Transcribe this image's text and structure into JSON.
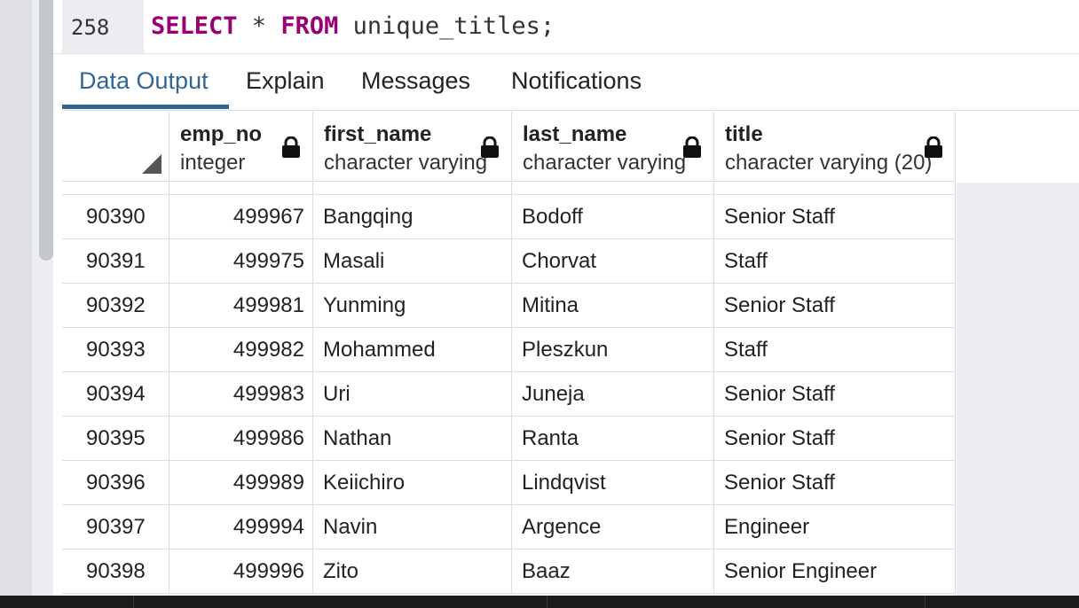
{
  "editor": {
    "line_number": "258",
    "kw_select": "SELECT",
    "star": " * ",
    "kw_from": "FROM",
    "rest": " unique_titles;"
  },
  "tabs": [
    {
      "label": "Data Output",
      "active": true
    },
    {
      "label": "Explain",
      "active": false
    },
    {
      "label": "Messages",
      "active": false
    },
    {
      "label": "Notifications",
      "active": false
    }
  ],
  "columns": [
    {
      "name": "emp_no",
      "type": "integer"
    },
    {
      "name": "first_name",
      "type": "character varying"
    },
    {
      "name": "last_name",
      "type": "character varying"
    },
    {
      "name": "title",
      "type": "character varying (20)"
    }
  ],
  "rows": [
    {
      "row": "90390",
      "emp_no": "499967",
      "first_name": "Bangqing",
      "last_name": "Bodoff",
      "title": "Senior Staff"
    },
    {
      "row": "90391",
      "emp_no": "499975",
      "first_name": "Masali",
      "last_name": "Chorvat",
      "title": "Staff"
    },
    {
      "row": "90392",
      "emp_no": "499981",
      "first_name": "Yunming",
      "last_name": "Mitina",
      "title": "Senior Staff"
    },
    {
      "row": "90393",
      "emp_no": "499982",
      "first_name": "Mohammed",
      "last_name": "Pleszkun",
      "title": "Staff"
    },
    {
      "row": "90394",
      "emp_no": "499983",
      "first_name": "Uri",
      "last_name": "Juneja",
      "title": "Senior Staff"
    },
    {
      "row": "90395",
      "emp_no": "499986",
      "first_name": "Nathan",
      "last_name": "Ranta",
      "title": "Senior Staff"
    },
    {
      "row": "90396",
      "emp_no": "499989",
      "first_name": "Keiichiro",
      "last_name": "Lindqvist",
      "title": "Senior Staff"
    },
    {
      "row": "90397",
      "emp_no": "499994",
      "first_name": "Navin",
      "last_name": "Argence",
      "title": "Engineer"
    },
    {
      "row": "90398",
      "emp_no": "499996",
      "first_name": "Zito",
      "last_name": "Baaz",
      "title": "Senior Engineer"
    }
  ],
  "icons": {
    "lock": "lock-icon",
    "corner": "select-all-corner-icon"
  },
  "colors": {
    "keyword": "#990077",
    "active_tab": "#326690",
    "grid_line": "#dadde1",
    "panel_bg": "#ebedf0"
  }
}
